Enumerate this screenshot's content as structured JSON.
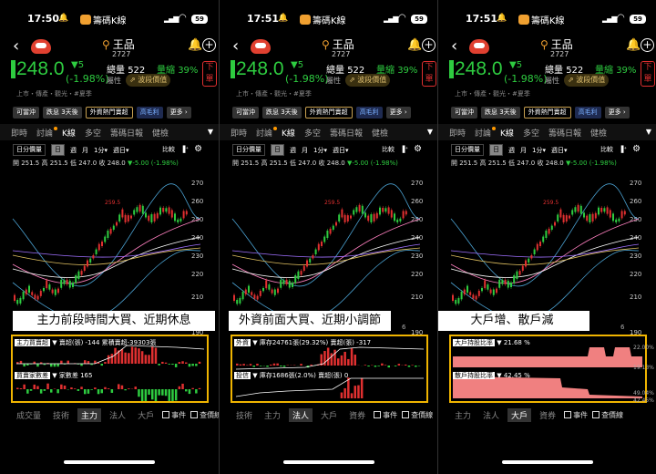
{
  "status": {
    "times": [
      "17:50",
      "17:51",
      "17:51"
    ],
    "app_name": "籌碼K線",
    "battery": "59"
  },
  "stock": {
    "name": "王品",
    "code": "2727",
    "price": "248.0",
    "change": "▼5",
    "change_pct": "(-1.98%)",
    "volume_label": "總量",
    "volume": "522",
    "ratio_label": "量縮",
    "ratio": "39%",
    "attr_label": "屬性",
    "wave_label": "波段價值",
    "tags": "上市・傳產・觀光・#夏季",
    "order_label": "下單"
  },
  "chips": [
    "可當沖",
    "跌息 3天後",
    "外資熱門賣超",
    "高毛利",
    "更多"
  ],
  "tabs": [
    "即時",
    "討論",
    "K線",
    "多空",
    "籌碼日報",
    "健檢"
  ],
  "controls": {
    "period": "日分價量",
    "day": "日",
    "week": "週",
    "month": "月",
    "minute": "1分",
    "weekday": "週日",
    "compare": "比較"
  },
  "ohlc": {
    "text": "開 251.5 高 251.5 低 247.0 收 248.0",
    "change": "▼-5.00 (-1.98%)"
  },
  "chart": {
    "y_ticks": [
      "270",
      "260",
      "250",
      "240",
      "230",
      "220",
      "210",
      "190"
    ],
    "max_label": "259.5",
    "x_label": "6"
  },
  "banners": [
    "主力前段時間大買、近期休息",
    "外資前面大買、近期小調節",
    "大戶增、散戶減"
  ],
  "indicators": [
    {
      "top_label": "主力買賣超",
      "top_text": "賣超(張) -144  累積賣超-39303張",
      "bottom_label": "買賣家數差",
      "bottom_text": "家數差 165"
    },
    {
      "top_label": "外資",
      "top_text": "庫存24761張(29.32%)  賣超(張) -317",
      "bottom_label": "投信",
      "bottom_text": "庫存1686張(2.0%)  賣超(張) 0"
    },
    {
      "top_label": "大戶持股比率",
      "top_text": "21.68 %",
      "bottom_label": "散戶持股比率",
      "bottom_text": "42.45 %",
      "side_values": [
        "22.00%",
        "19.13%",
        "49.04%",
        "42.45%"
      ]
    }
  ],
  "bottom_tabs": [
    [
      "成交量",
      "技術",
      "主力",
      "法人",
      "大戶"
    ],
    [
      "技術",
      "主力",
      "法人",
      "大戶",
      "資券"
    ],
    [
      "主力",
      "法人",
      "大戶",
      "資券"
    ]
  ],
  "active_bottom": [
    "主力",
    "法人",
    "大戶"
  ],
  "checkboxes": [
    "事件",
    "查價線"
  ],
  "colors": {
    "up": "#e03030",
    "down": "#2ecc40",
    "highlight": "#f0b400"
  }
}
